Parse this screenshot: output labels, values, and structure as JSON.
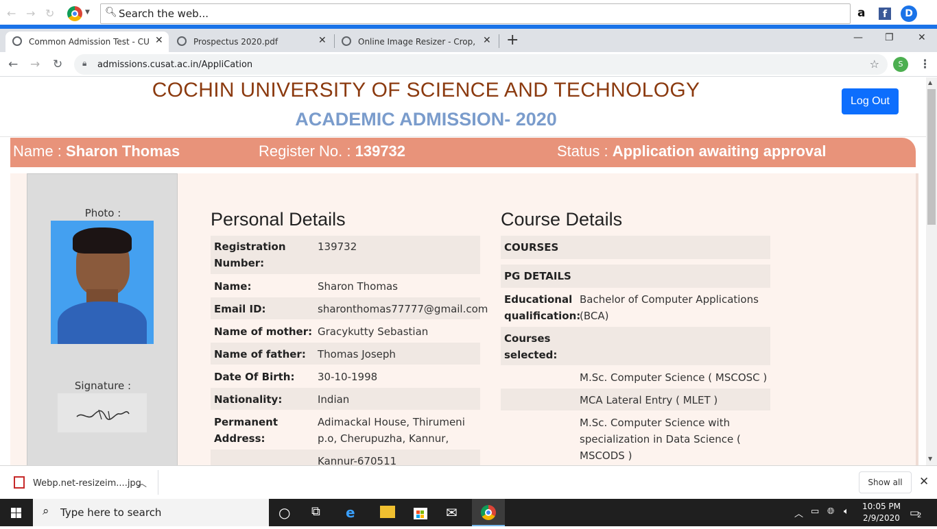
{
  "browser": {
    "search_placeholder": "Search the web...",
    "tabs": [
      {
        "label": "Common Admission Test - CUSAT",
        "active": true
      },
      {
        "label": "Prospectus 2020.pdf",
        "active": false
      },
      {
        "label": "Online Image Resizer - Crop, Resize",
        "active": false
      }
    ],
    "new_tab": "+",
    "url": "admissions.cusat.ac.in/AppliCation",
    "profile_initial": "S"
  },
  "page": {
    "univ_title": "COCHIN UNIVERSITY OF SCIENCE AND TECHNOLOGY",
    "adm_title": "ACADEMIC ADMISSION- 2020",
    "logout": "Log Out",
    "status": {
      "name_label": "Name : ",
      "name": "Sharon Thomas",
      "reg_label": "Register No. : ",
      "reg_no": "139732",
      "status_label": "Status : ",
      "status_value": "Application awaiting approval"
    },
    "photo_label": "Photo :",
    "signature_label": "Signature :",
    "personal_title": "Personal Details",
    "personal": {
      "reg_key": "Registration Number:",
      "reg_val": "139732",
      "name_key": "Name:",
      "name_val": "Sharon Thomas",
      "email_key": "Email ID:",
      "email_val": "sharonthomas77777@gmail.com",
      "mother_key": "Name of mother:",
      "mother_val": "Gracykutty Sebastian",
      "father_key": "Name of father:",
      "father_val": "Thomas Joseph",
      "dob_key": "Date Of Birth:",
      "dob_val": "30-10-1998",
      "nat_key": "Nationality:",
      "nat_val": "Indian",
      "addr_key": "Permanent Address:",
      "addr_val": "Adimackal House, Thirumeni p.o, Cherupuzha, Kannur, 670511",
      "addr2_val": "Kannur-670511"
    },
    "course_title": "Course Details",
    "course": {
      "courses_hdr": "COURSES",
      "pg_hdr": "PG DETAILS",
      "edu_key": "Educational qualification:",
      "edu_val": "Bachelor of Computer Applications (BCA)",
      "sel_key": "Courses selected:",
      "c1": "M.Sc. Computer Science ( MSCOSC )",
      "c2": "MCA Lateral Entry ( MLET )",
      "c3": "M.Sc. Computer Science with specialization in Data Science ( MSCODS )"
    }
  },
  "download": {
    "file": "Webp.net-resizeim....jpg",
    "show_all": "Show all"
  },
  "taskbar": {
    "search": "Type here to search",
    "time": "10:05 PM",
    "date": "2/9/2020",
    "notif_count": "2"
  },
  "colors": {
    "status_bar": "#e8937a",
    "univ_title": "#8b3a0f",
    "adm_title": "#7a9ccc",
    "logout": "#0d6efd"
  }
}
